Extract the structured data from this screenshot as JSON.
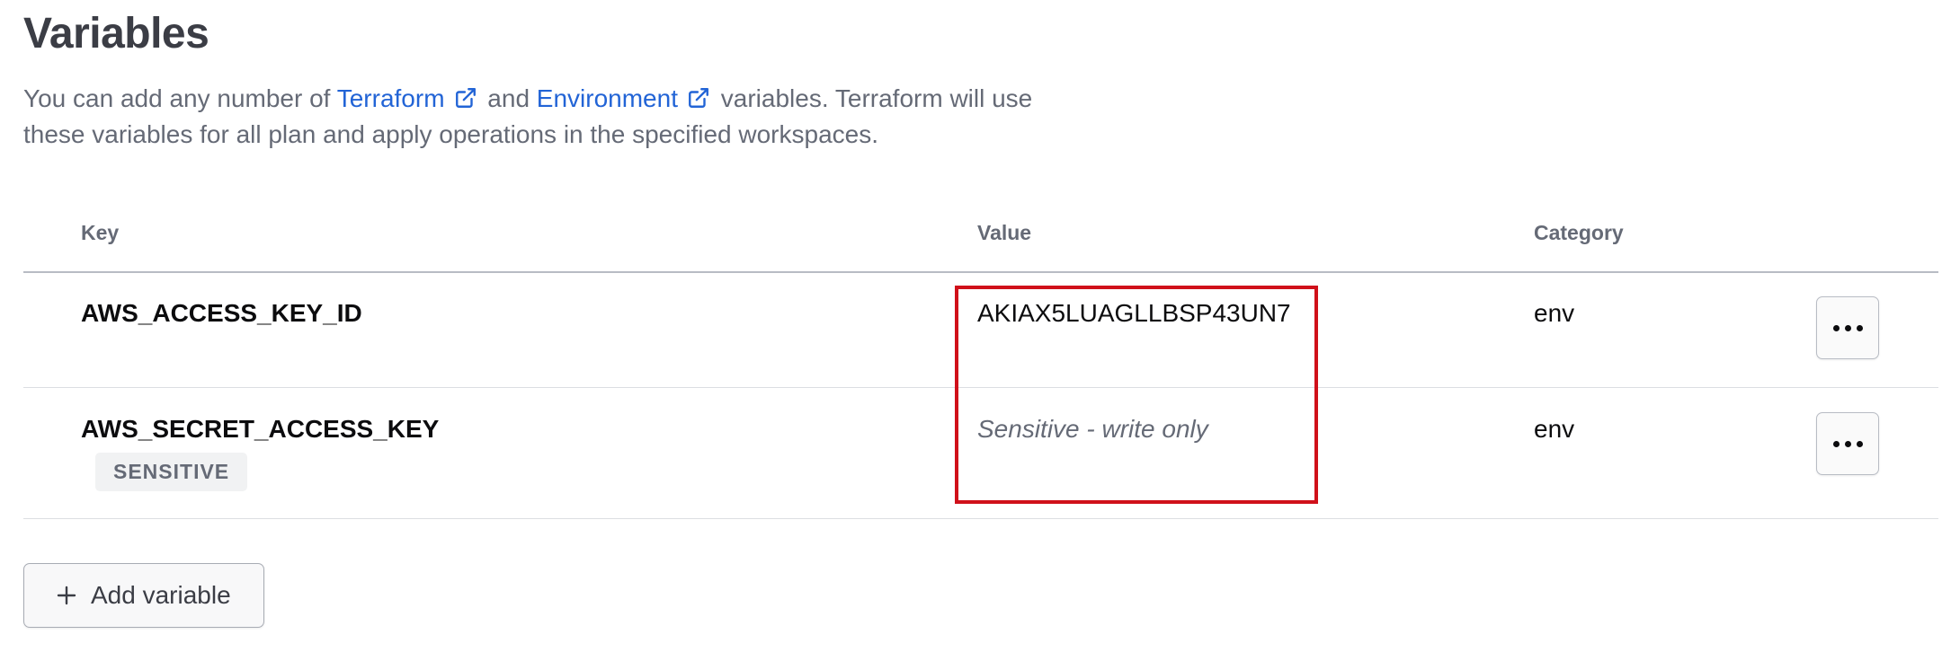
{
  "page": {
    "title": "Variables",
    "description": {
      "before": "You can add any number of ",
      "link1": "Terraform",
      "middle": " and ",
      "link2": "Environment",
      "after": " variables. Terraform will use these variables for all plan and apply operations in the specified workspaces."
    }
  },
  "table": {
    "headers": {
      "key": "Key",
      "value": "Value",
      "category": "Category"
    },
    "rows": [
      {
        "key": "AWS_ACCESS_KEY_ID",
        "badge": "",
        "value": "AKIAX5LUAGLLBSP43UN7",
        "category": "env"
      },
      {
        "key": "AWS_SECRET_ACCESS_KEY",
        "badge": "SENSITIVE",
        "value": "Sensitive - write only",
        "category": "env"
      }
    ]
  },
  "actions": {
    "add_variable": "Add variable"
  },
  "icons": {
    "external_link": "external-link-icon",
    "more": "more-horizontal-icon",
    "plus": "plus-icon"
  },
  "colors": {
    "link": "#2264d6",
    "highlight_border": "#d0101a",
    "muted_text": "#656a76"
  }
}
